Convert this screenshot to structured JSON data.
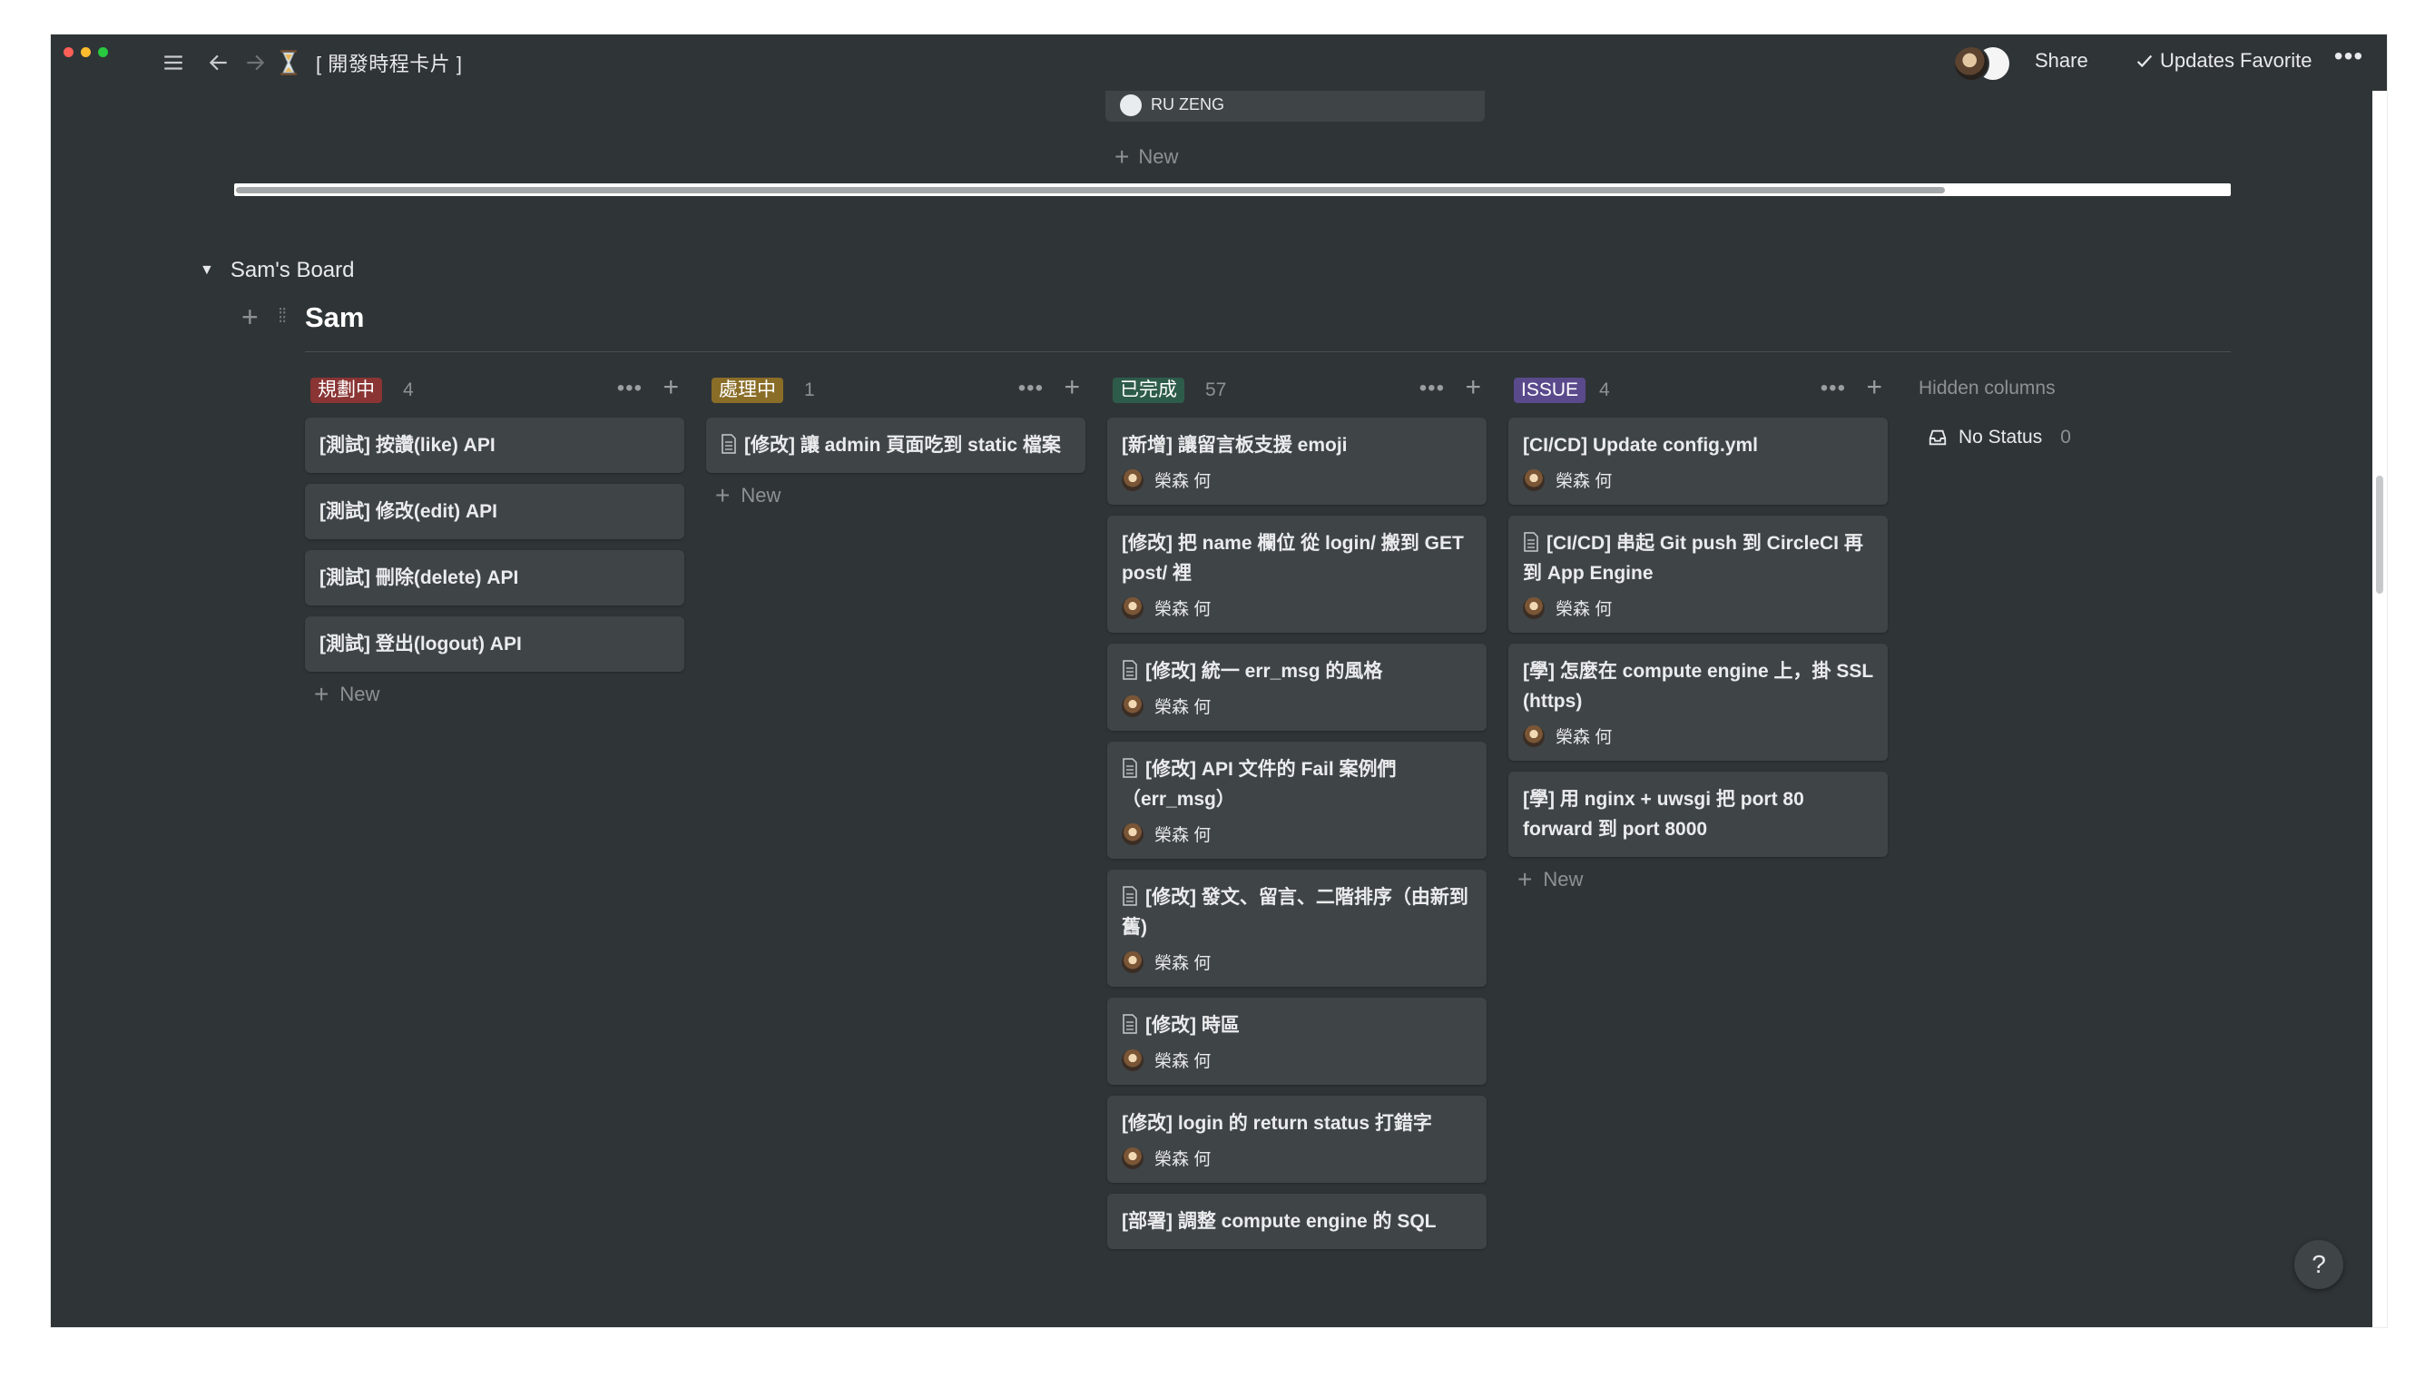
{
  "window": {
    "page_title": "[ 開發時程卡片 ]",
    "actions": {
      "share": "Share",
      "updates": "Updates",
      "favorite": "Favorite",
      "more": "•••"
    }
  },
  "prev_board": {
    "card_person": "RU ZENG",
    "new_label": "New"
  },
  "board": {
    "toggle_label": "Sam's Board",
    "group_title": "Sam",
    "hidden_columns_label": "Hidden columns",
    "no_status": {
      "label": "No Status",
      "count": "0"
    },
    "columns": [
      {
        "tag": "規劃中",
        "tag_bg": "#8a3434",
        "tag_fg": "#ffffff",
        "count": "4",
        "cards": [
          {
            "title": "[測試] 按讚(like) API"
          },
          {
            "title": "[測試] 修改(edit) API"
          },
          {
            "title": "[測試] 刪除(delete) API"
          },
          {
            "title": "[測試] 登出(logout) API"
          }
        ],
        "new_label": "New"
      },
      {
        "tag": "處理中",
        "tag_bg": "#8a6d27",
        "tag_fg": "#ffffff",
        "count": "1",
        "cards": [
          {
            "title": "[修改] 讓 admin 頁面吃到 static 檔案",
            "doc": true
          }
        ],
        "new_label": "New"
      },
      {
        "tag": "已完成",
        "tag_bg": "#2e5c4a",
        "tag_fg": "#ffffff",
        "count": "57",
        "cards": [
          {
            "title": "[新增] 讓留言板支援 emoji",
            "person": "榮森 何"
          },
          {
            "title": "[修改] 把 name 欄位 從 login/ 搬到 GET post/ 裡",
            "person": "榮森 何"
          },
          {
            "title": "[修改] 統一 err_msg 的風格",
            "doc": true,
            "person": "榮森 何"
          },
          {
            "title": "[修改] API 文件的 Fail 案例們（err_msg）",
            "doc": true,
            "person": "榮森 何"
          },
          {
            "title": "[修改] 發文、留言、二階排序（由新到舊)",
            "doc": true,
            "person": "榮森 何"
          },
          {
            "title": "[修改] 時區",
            "doc": true,
            "person": "榮森 何"
          },
          {
            "title": "[修改] login 的 return status 打錯字",
            "person": "榮森 何"
          },
          {
            "title": "[部署] 調整 compute engine 的 SQL"
          }
        ]
      },
      {
        "tag": "ISSUE",
        "tag_bg": "#5a4a8c",
        "tag_fg": "#ffffff",
        "count": "4",
        "cards": [
          {
            "title": "[CI/CD] Update config.yml",
            "person": "榮森 何"
          },
          {
            "title": "[CI/CD] 串起 Git push 到 CircleCI 再到 App Engine",
            "doc": true,
            "person": "榮森 何"
          },
          {
            "title": "[學] 怎麼在 compute engine 上，掛 SSL (https)",
            "person": "榮森 何"
          },
          {
            "title": "[學] 用 nginx + uwsgi 把 port 80 forward 到 port 8000"
          }
        ],
        "new_label": "New"
      }
    ]
  },
  "help_label": "?"
}
